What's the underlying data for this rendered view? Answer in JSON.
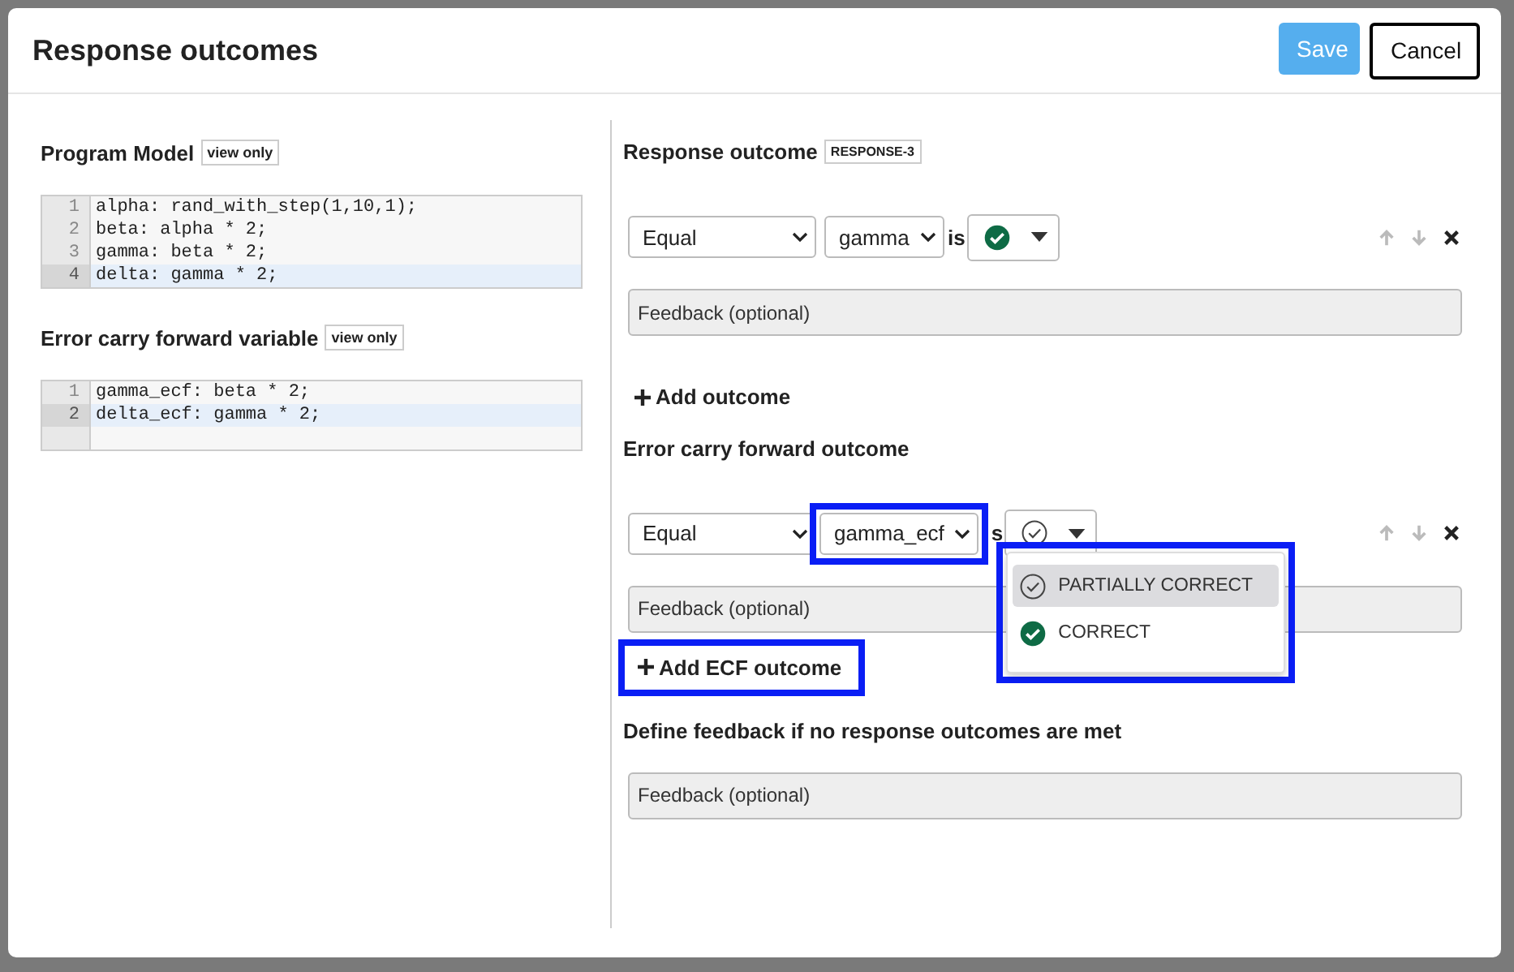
{
  "dialog": {
    "title": "Response outcomes",
    "buttons": [
      {
        "label": "Save",
        "kind": "primary"
      },
      {
        "label": "Cancel",
        "kind": "secondary"
      }
    ]
  },
  "left": {
    "sections": [
      {
        "title": "Program Model",
        "badge": "view only",
        "empty_row": false,
        "lines": [
          {
            "number": "1",
            "code": "alpha: rand_with_step(1,10,1);",
            "active": false
          },
          {
            "number": "2",
            "code": "beta: alpha * 2;",
            "active": false
          },
          {
            "number": "3",
            "code": "gamma: beta * 2;",
            "active": false
          },
          {
            "number": "4",
            "code": "delta: gamma * 2;",
            "active": true
          }
        ]
      },
      {
        "title": "Error carry forward variable",
        "badge": "view only",
        "empty_row": true,
        "lines": [
          {
            "number": "1",
            "code": "gamma_ecf: beta * 2;",
            "active": false
          },
          {
            "number": "2",
            "code": "delta_ecf: gamma * 2;",
            "active": true
          }
        ]
      }
    ]
  },
  "right": {
    "groups": [
      {
        "title": "Response outcome",
        "tag": "RESPONSE-3",
        "rows": [
          {
            "operator": "Equal",
            "variable": "gamma",
            "variable_highlighted": false,
            "connector": "is",
            "correct": true,
            "move_up_disabled": true,
            "move_down_disabled": true,
            "feedback_placeholder": "Feedback (optional)"
          }
        ],
        "add_button": {
          "label": "Add outcome",
          "highlighted": false
        }
      },
      {
        "title": "Error carry forward outcome",
        "rows": [
          {
            "operator": "Equal",
            "variable": "gamma_ecf",
            "variable_highlighted": true,
            "connector": "s",
            "correct": false,
            "move_up_disabled": true,
            "move_down_disabled": true,
            "feedback_placeholder": "Feedback (optional)",
            "menu": {
              "highlighted": true,
              "items": [
                {
                  "label": "PARTIALLY CORRECT",
                  "kind": "partial",
                  "selected": true
                },
                {
                  "label": "CORRECT",
                  "kind": "correct",
                  "selected": false
                }
              ]
            }
          }
        ],
        "add_button": {
          "label": "Add ECF outcome",
          "highlighted": true
        }
      }
    ],
    "default_feedback": {
      "title": "Define feedback if no response outcomes are met",
      "placeholder": "Feedback (optional)"
    }
  }
}
